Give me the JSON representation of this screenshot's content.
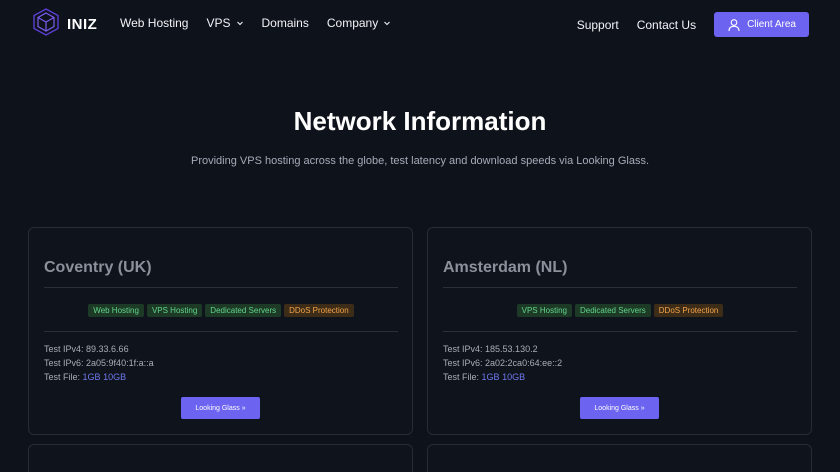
{
  "brand": {
    "name": "INIZ",
    "logo_icon": "cube-logo-icon",
    "accent": "#6c63f0"
  },
  "nav": {
    "links": [
      {
        "label": "Web Hosting",
        "dropdown": false
      },
      {
        "label": "VPS",
        "dropdown": true
      },
      {
        "label": "Domains",
        "dropdown": false
      },
      {
        "label": "Company",
        "dropdown": true
      }
    ],
    "support": "Support",
    "contact": "Contact Us",
    "client_area": "Client Area"
  },
  "hero": {
    "title": "Network Information",
    "subtitle": "Providing VPS hosting across the globe, test latency and download speeds via Looking Glass."
  },
  "locations": [
    {
      "name": "Coventry (UK)",
      "tags": [
        {
          "label": "Web Hosting",
          "color": "green"
        },
        {
          "label": "VPS Hosting",
          "color": "green"
        },
        {
          "label": "Dedicated Servers",
          "color": "green"
        },
        {
          "label": "DDoS Protection",
          "color": "orange"
        }
      ],
      "ipv4_label": "Test IPv4:",
      "ipv4": "89.33.6.66",
      "ipv6_label": "Test IPv6:",
      "ipv6": "2a05:9f40:1f:a::a",
      "file_label": "Test File:",
      "file_1gb": "1GB",
      "file_10gb": "10GB",
      "button": "Looking Glass »"
    },
    {
      "name": "Amsterdam (NL)",
      "tags": [
        {
          "label": "VPS Hosting",
          "color": "green"
        },
        {
          "label": "Dedicated Servers",
          "color": "green"
        },
        {
          "label": "DDoS Protection",
          "color": "orange"
        }
      ],
      "ipv4_label": "Test IPv4:",
      "ipv4": "185.53.130.2",
      "ipv6_label": "Test IPv6:",
      "ipv6": "2a02:2ca0:64:ee::2",
      "file_label": "Test File:",
      "file_1gb": "1GB",
      "file_10gb": "10GB",
      "button": "Looking Glass »"
    }
  ]
}
